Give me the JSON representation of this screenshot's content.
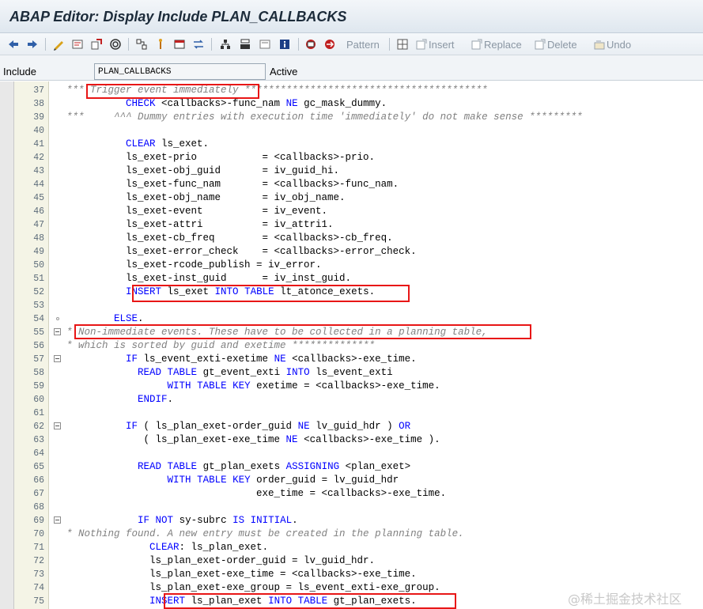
{
  "window": {
    "title": "ABAP Editor: Display Include PLAN_CALLBACKS"
  },
  "toolbar": {
    "icons": [
      "back-icon",
      "forward-icon",
      "other-object-icon",
      "display-change-icon",
      "active-inactive-icon",
      "activate-icon",
      "where-used-icon",
      "object-list-icon",
      "display-object-icon",
      "navigation-window-icon",
      "enhance-icon",
      "set-breakpoint-icon",
      "help-icon",
      "pattern-icon",
      "pretty-printer-icon",
      "insert-icon",
      "replace-icon",
      "delete-icon",
      "undo-icon"
    ],
    "pattern_label": "Pattern",
    "insert_label": "Insert",
    "replace_label": "Replace",
    "delete_label": "Delete",
    "undo_label": "Undo"
  },
  "fieldbar": {
    "include_label": "Include",
    "include_value": "PLAN_CALLBACKS",
    "status": "Active"
  },
  "colors": {
    "keyword": "#0000ff",
    "comment": "#808080",
    "highlight": "#e81616"
  },
  "lines": [
    {
      "n": "37",
      "code": "*** Trigger event immediately *****************************************",
      "kind": "comment"
    },
    {
      "n": "38",
      "code": "          CHECK <callbacks>-func_nam NE gc_mask_dummy.",
      "kind": "code"
    },
    {
      "n": "39",
      "code": "***     ^^^ Dummy entries with execution time 'immediately' do not make sense *********",
      "kind": "comment"
    },
    {
      "n": "40",
      "code": "",
      "kind": "code"
    },
    {
      "n": "41",
      "code": "          CLEAR ls_exet.",
      "kind": "code"
    },
    {
      "n": "42",
      "code": "          ls_exet-prio           = <callbacks>-prio.",
      "kind": "code"
    },
    {
      "n": "43",
      "code": "          ls_exet-obj_guid       = iv_guid_hi.",
      "kind": "code"
    },
    {
      "n": "44",
      "code": "          ls_exet-func_nam       = <callbacks>-func_nam.",
      "kind": "code"
    },
    {
      "n": "45",
      "code": "          ls_exet-obj_name       = iv_obj_name.",
      "kind": "code"
    },
    {
      "n": "46",
      "code": "          ls_exet-event          = iv_event.",
      "kind": "code"
    },
    {
      "n": "47",
      "code": "          ls_exet-attri          = iv_attri1.",
      "kind": "code"
    },
    {
      "n": "48",
      "code": "          ls_exet-cb_freq        = <callbacks>-cb_freq.",
      "kind": "code"
    },
    {
      "n": "49",
      "code": "          ls_exet-error_check    = <callbacks>-error_check.",
      "kind": "code"
    },
    {
      "n": "50",
      "code": "          ls_exet-rcode_publish = iv_error.",
      "kind": "code"
    },
    {
      "n": "51",
      "code": "          ls_exet-inst_guid      = iv_inst_guid.",
      "kind": "code"
    },
    {
      "n": "52",
      "code": "          INSERT ls_exet INTO TABLE lt_atonce_exets.",
      "kind": "code"
    },
    {
      "n": "53",
      "code": "",
      "kind": "code"
    },
    {
      "n": "54",
      "code": "        ELSE.",
      "kind": "code",
      "marker": "dot"
    },
    {
      "n": "55",
      "code": "* Non-immediate events. These have to be collected in a planning table,",
      "kind": "comment",
      "marker": "fold"
    },
    {
      "n": "56",
      "code": "* which is sorted by guid and exetime **************",
      "kind": "comment"
    },
    {
      "n": "57",
      "code": "          IF ls_event_exti-exetime NE <callbacks>-exe_time.",
      "kind": "code",
      "marker": "fold"
    },
    {
      "n": "58",
      "code": "            READ TABLE gt_event_exti INTO ls_event_exti",
      "kind": "code"
    },
    {
      "n": "59",
      "code": "                 WITH TABLE KEY exetime = <callbacks>-exe_time.",
      "kind": "code"
    },
    {
      "n": "60",
      "code": "            ENDIF.",
      "kind": "code"
    },
    {
      "n": "61",
      "code": "",
      "kind": "code"
    },
    {
      "n": "62",
      "code": "          IF ( ls_plan_exet-order_guid NE lv_guid_hdr ) OR",
      "kind": "code",
      "marker": "fold"
    },
    {
      "n": "63",
      "code": "             ( ls_plan_exet-exe_time NE <callbacks>-exe_time ).",
      "kind": "code"
    },
    {
      "n": "64",
      "code": "",
      "kind": "code"
    },
    {
      "n": "65",
      "code": "            READ TABLE gt_plan_exets ASSIGNING <plan_exet>",
      "kind": "code"
    },
    {
      "n": "66",
      "code": "                 WITH TABLE KEY order_guid = lv_guid_hdr",
      "kind": "code"
    },
    {
      "n": "67",
      "code": "                                exe_time = <callbacks>-exe_time.",
      "kind": "code"
    },
    {
      "n": "68",
      "code": "",
      "kind": "code"
    },
    {
      "n": "69",
      "code": "            IF NOT sy-subrc IS INITIAL.",
      "kind": "code",
      "marker": "fold"
    },
    {
      "n": "70",
      "code": "* Nothing found. A new entry must be created in the planning table.",
      "kind": "comment"
    },
    {
      "n": "71",
      "code": "              CLEAR: ls_plan_exet.",
      "kind": "code"
    },
    {
      "n": "72",
      "code": "              ls_plan_exet-order_guid = lv_guid_hdr.",
      "kind": "code"
    },
    {
      "n": "73",
      "code": "              ls_plan_exet-exe_time = <callbacks>-exe_time.",
      "kind": "code"
    },
    {
      "n": "74",
      "code": "              ls_plan_exet-exe_group = ls_event_exti-exe_group.",
      "kind": "code"
    },
    {
      "n": "75",
      "code": "              INSERT ls_plan_exet INTO TABLE gt_plan_exets.",
      "kind": "code"
    }
  ],
  "keywords": [
    "CHECK",
    "NE",
    "CLEAR",
    "INSERT",
    "INTO",
    "TABLE",
    "ELSE",
    "IF",
    "READ",
    "WITH",
    "KEY",
    "ENDIF",
    "OR",
    "ASSIGNING",
    "NOT",
    "IS",
    "INITIAL"
  ],
  "watermark": "@稀土掘金技术社区"
}
